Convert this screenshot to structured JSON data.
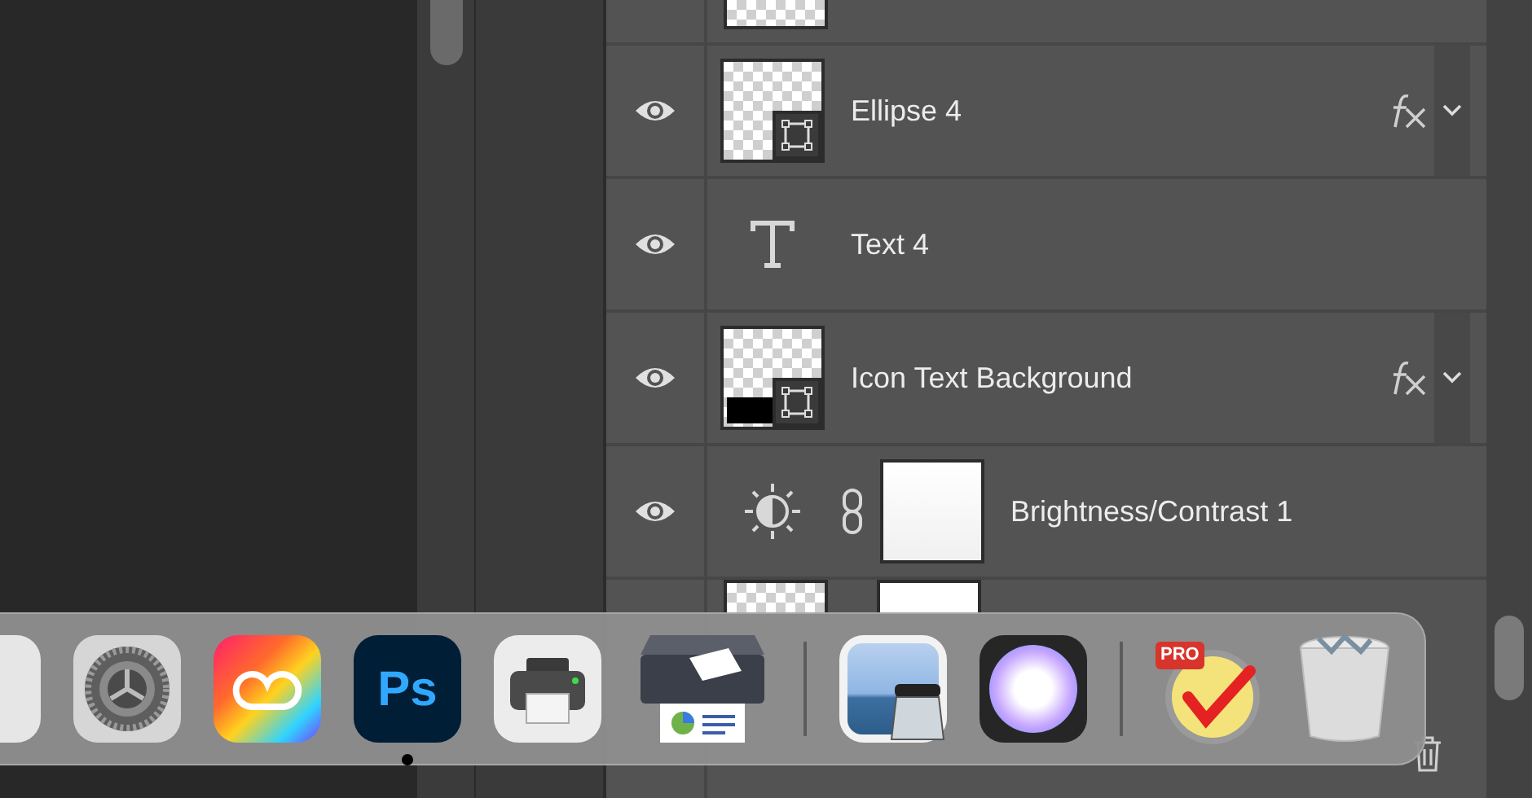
{
  "layers": [
    {
      "kind": "shape",
      "name": "Ellipse 4",
      "visible": true,
      "thumb_bar": false,
      "effects": true
    },
    {
      "kind": "text",
      "name": "Text 4",
      "visible": true,
      "effects": false
    },
    {
      "kind": "shape",
      "name": "Icon Text Background",
      "visible": true,
      "thumb_bar": true,
      "effects": true
    },
    {
      "kind": "adjustment",
      "name": "Brightness/Contrast 1",
      "visible": true,
      "linked": true,
      "effects": false
    }
  ],
  "dock": {
    "items": [
      {
        "kind": "partial",
        "running": false
      },
      {
        "kind": "gear",
        "running": false
      },
      {
        "kind": "rainbow",
        "running": false
      },
      {
        "kind": "ps",
        "label": "Ps",
        "running": true
      },
      {
        "kind": "printer",
        "running": false
      },
      {
        "kind": "scanner",
        "running": false
      },
      {
        "kind": "separator"
      },
      {
        "kind": "preview",
        "running": false
      },
      {
        "kind": "pet",
        "running": false
      },
      {
        "kind": "separator"
      },
      {
        "kind": "checklist",
        "label": "PRO",
        "running": false
      },
      {
        "kind": "trash",
        "running": false
      }
    ]
  }
}
